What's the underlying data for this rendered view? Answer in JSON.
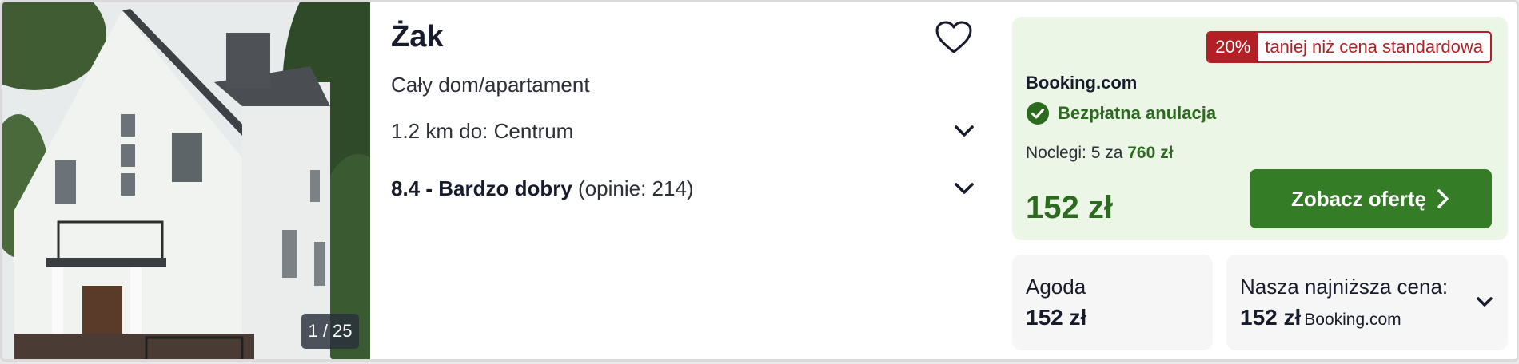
{
  "listing": {
    "name": "Żak",
    "type": "Cały dom/apartament",
    "distance": "1.2 km do: Centrum",
    "rating_score": "8.4 - Bardzo dobry",
    "rating_reviews": " (opinie: 214)",
    "photo_counter": "1 / 25"
  },
  "offer": {
    "discount_pct": "20%",
    "discount_text": "taniej niż cena standardowa",
    "provider": "Booking.com",
    "cancellation": "Bezpłatna anulacja",
    "nights_prefix": "Noclegi: 5 za ",
    "nights_total": "760 zł",
    "price": "152 zł",
    "cta_label": "Zobacz ofertę"
  },
  "alternatives": [
    {
      "provider": "Agoda",
      "price": "152 zł"
    },
    {
      "title": "Nasza najniższa cena:",
      "price": "152 zł",
      "source": "Booking.com"
    }
  ],
  "icons": {
    "favorite": "heart-outline-icon",
    "expand": "chevron-down-icon",
    "check": "check-circle-icon",
    "cta": "chevron-right-icon"
  },
  "colors": {
    "accent_green": "#347c25",
    "price_green": "#2c6b1f",
    "discount_red": "#b21f24",
    "offer_bg": "#ecf6e7"
  }
}
